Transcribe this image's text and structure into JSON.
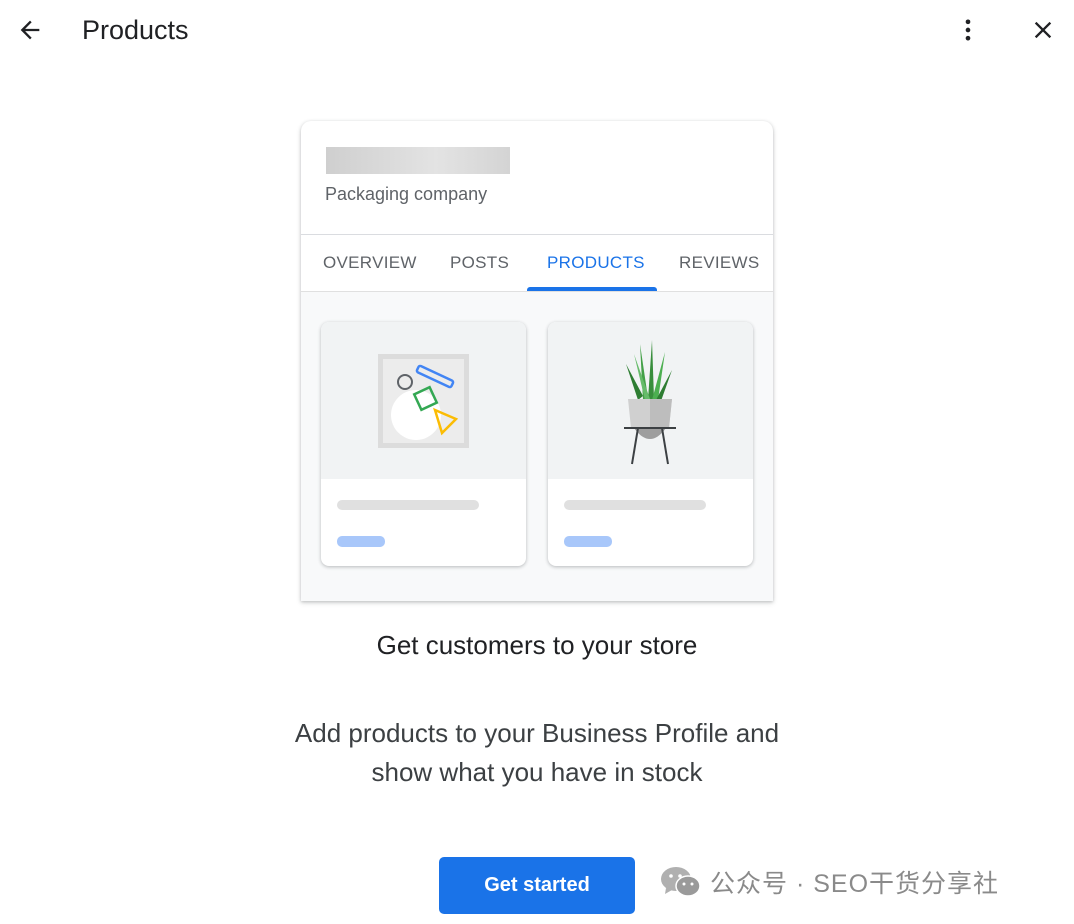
{
  "header": {
    "title": "Products",
    "back_icon": "arrow-back-icon",
    "more_icon": "more-vert-icon",
    "close_icon": "close-icon"
  },
  "preview": {
    "category": "Packaging company",
    "tabs": [
      {
        "label": "OVERVIEW",
        "active": false
      },
      {
        "label": "POSTS",
        "active": false
      },
      {
        "label": "PRODUCTS",
        "active": true
      },
      {
        "label": "REVIEWS",
        "active": false
      }
    ],
    "products": [
      {
        "image_icon": "shapes-illustration-icon"
      },
      {
        "image_icon": "potted-plant-icon"
      }
    ]
  },
  "main": {
    "headline": "Get customers to your store",
    "description": "Add products to your Business Profile and show what you have in stock",
    "cta_label": "Get started"
  },
  "watermark": {
    "text": "公众号 · SEO干货分享社",
    "icon": "wechat-icon"
  },
  "colors": {
    "accent": "#1a73e8",
    "text_primary": "#202124",
    "text_secondary": "#5f6368",
    "placeholder_blue": "#a8c7fa"
  }
}
